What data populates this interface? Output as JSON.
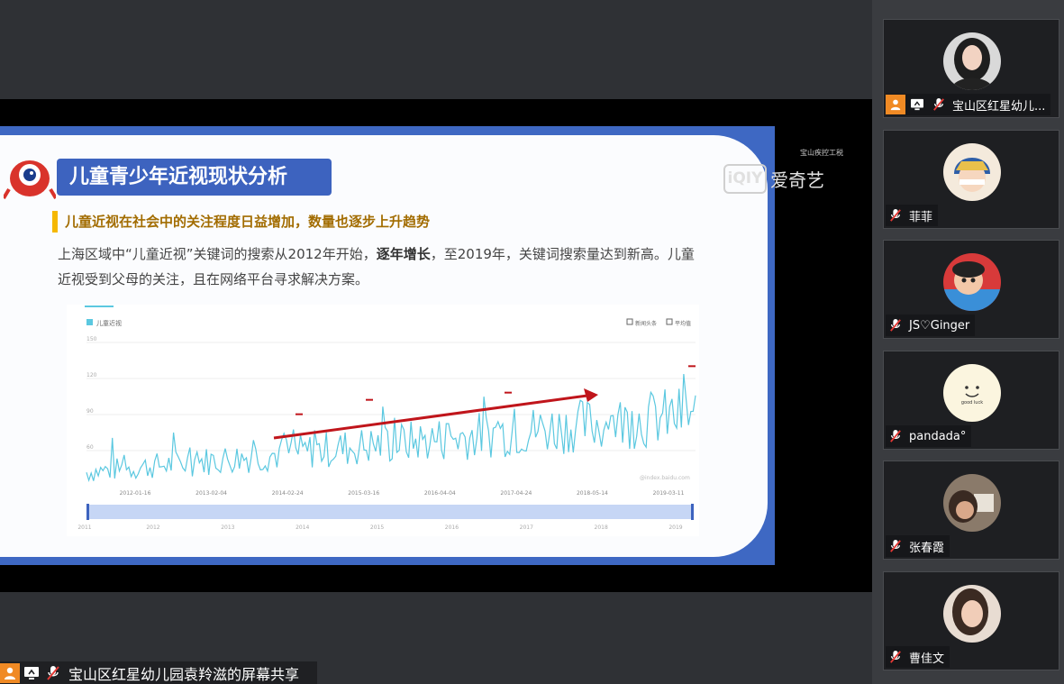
{
  "slide": {
    "title": "儿童青少年近视现状分析",
    "subhead": "儿童近视在社会中的关注程度日益增加，数量也逐步上升趋势",
    "body_prefix": "上海区域中“儿童近视”关键词的搜索从2012年开始，",
    "body_bold": "逐年增长",
    "body_suffix": "，至2019年，关键词搜索量达到新高。儿童近视受到父母的关注，且在网络平台寻求解决方案。"
  },
  "chart_data": {
    "type": "line",
    "legend": "儿童近视",
    "legend_right": [
      "新闻头条",
      "平均值"
    ],
    "y_ticks": [
      "150",
      "120",
      "90",
      "60"
    ],
    "x_ticks": [
      "2012-01-16",
      "2013-02-04",
      "2014-02-24",
      "2015-03-16",
      "2016-04-04",
      "2017-04-24",
      "2018-05-14",
      "2019-03-11"
    ],
    "year_ticks": [
      "2011",
      "2012",
      "2013",
      "2014",
      "2015",
      "2016",
      "2017",
      "2018",
      "2019"
    ],
    "watermark": "@index.baidu.com",
    "ylim": [
      0,
      150
    ],
    "colors": {
      "line": "#5bc8e0",
      "trend_arrow": "#c0151b",
      "peak_marker": "#c0151b"
    }
  },
  "watermarks": {
    "small": "宝山疾控工税",
    "logo_box": "iQIY",
    "logo_text": "爱奇艺"
  },
  "share_bar": {
    "label": "宝山区红星幼儿园袁羚滋的屏幕共享"
  },
  "participants": [
    {
      "name": "宝山区红星幼儿...",
      "avatar_icon": "woman-portrait-avatar",
      "host": true
    },
    {
      "name": "菲菲",
      "avatar_icon": "cartoon-girl-avatar",
      "host": false
    },
    {
      "name": "JS♡Ginger",
      "avatar_icon": "cartoon-red-avatar",
      "host": false
    },
    {
      "name": "pandada°",
      "avatar_icon": "smiley-avatar",
      "avatar_text": "good luck",
      "host": false
    },
    {
      "name": "张春霞",
      "avatar_icon": "photo-avatar",
      "host": false
    },
    {
      "name": "曹佳文",
      "avatar_icon": "girl-photo-avatar",
      "host": false
    }
  ],
  "icons": {
    "user": "user-icon",
    "screen": "screen-share-icon",
    "mic_muted": "mic-muted-icon"
  },
  "colors": {
    "slide_blue": "#3e68c3",
    "accent_orange": "#f08a24"
  }
}
